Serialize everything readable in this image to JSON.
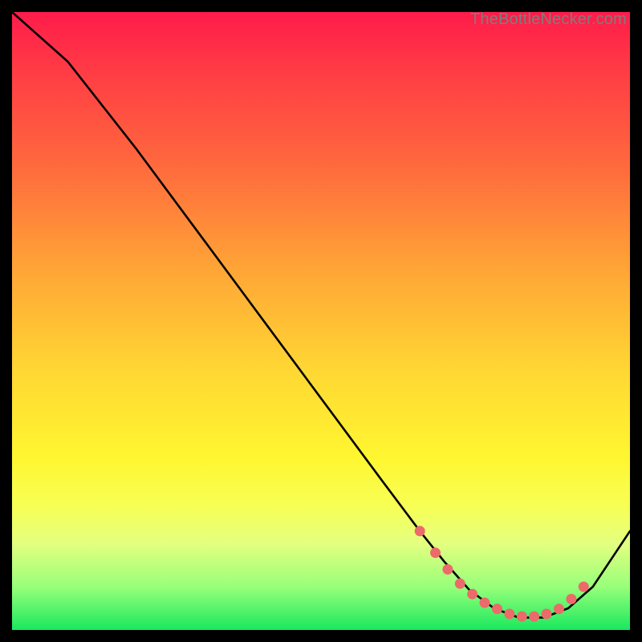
{
  "watermark": "TheBottleNecker.com",
  "chart_data": {
    "type": "line",
    "title": "",
    "xlabel": "",
    "ylabel": "",
    "xlim": [
      0,
      100
    ],
    "ylim": [
      0,
      100
    ],
    "series": [
      {
        "name": "curve",
        "color": "#000000",
        "x": [
          0,
          9,
          20,
          30,
          40,
          50,
          60,
          66,
          70,
          74,
          78,
          82,
          86,
          90,
          94,
          100
        ],
        "y": [
          100,
          92,
          78,
          64.5,
          51,
          37.5,
          24,
          16,
          11,
          6.5,
          3.5,
          2,
          2,
          3.5,
          7,
          16
        ]
      }
    ],
    "markers": {
      "name": "dotted-valley",
      "color": "#ec6a6a",
      "x": [
        66,
        68.5,
        70.5,
        72.5,
        74.5,
        76.5,
        78.5,
        80.5,
        82.5,
        84.5,
        86.5,
        88.5,
        90.5,
        92.5
      ],
      "y": [
        16,
        12.5,
        9.8,
        7.5,
        5.8,
        4.4,
        3.4,
        2.6,
        2.2,
        2.2,
        2.6,
        3.4,
        5,
        7
      ]
    },
    "gradient_stops": [
      {
        "pos": 0.0,
        "color": "#ff1b4a"
      },
      {
        "pos": 0.09,
        "color": "#ff3a45"
      },
      {
        "pos": 0.25,
        "color": "#ff6a3d"
      },
      {
        "pos": 0.42,
        "color": "#ffa636"
      },
      {
        "pos": 0.58,
        "color": "#ffd733"
      },
      {
        "pos": 0.72,
        "color": "#fff630"
      },
      {
        "pos": 0.8,
        "color": "#f7ff55"
      },
      {
        "pos": 0.86,
        "color": "#e4ff80"
      },
      {
        "pos": 0.93,
        "color": "#98ff7a"
      },
      {
        "pos": 1.0,
        "color": "#19e85e"
      }
    ]
  }
}
